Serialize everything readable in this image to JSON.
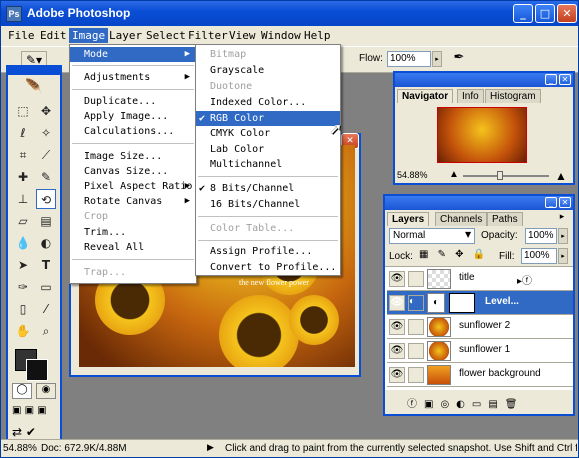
{
  "app": {
    "title": "Adobe Photoshop",
    "icon": "Ps"
  },
  "window_controls": {
    "minimize": "_",
    "maximize": "□",
    "close": "✕"
  },
  "menubar": [
    "File",
    "Edit",
    "Image",
    "Layer",
    "Select",
    "Filter",
    "View",
    "Window",
    "Help"
  ],
  "options_bar": {
    "flow_label": "Flow:",
    "flow_value": "100%"
  },
  "image_menu": {
    "items": [
      {
        "label": "Mode",
        "submenu": true,
        "enabled": true,
        "selected": true
      },
      {
        "label": "Adjustments",
        "submenu": true,
        "enabled": true
      },
      {
        "label": "Duplicate...",
        "enabled": true
      },
      {
        "label": "Apply Image...",
        "enabled": true
      },
      {
        "label": "Calculations...",
        "enabled": true
      },
      {
        "label": "Image Size...",
        "enabled": true
      },
      {
        "label": "Canvas Size...",
        "enabled": true
      },
      {
        "label": "Pixel Aspect Ratio",
        "submenu": true,
        "enabled": true
      },
      {
        "label": "Rotate Canvas",
        "submenu": true,
        "enabled": true
      },
      {
        "label": "Crop",
        "enabled": false
      },
      {
        "label": "Trim...",
        "enabled": true
      },
      {
        "label": "Reveal All",
        "enabled": true
      },
      {
        "label": "Trap...",
        "enabled": false
      }
    ]
  },
  "mode_submenu": {
    "items": [
      {
        "label": "Bitmap",
        "enabled": false
      },
      {
        "label": "Grayscale",
        "enabled": true
      },
      {
        "label": "Duotone",
        "enabled": false
      },
      {
        "label": "Indexed Color...",
        "enabled": true
      },
      {
        "label": "RGB Color",
        "enabled": true,
        "checked": true,
        "selected": true
      },
      {
        "label": "CMYK Color",
        "enabled": true
      },
      {
        "label": "Lab Color",
        "enabled": true
      },
      {
        "label": "Multichannel",
        "enabled": true
      },
      {
        "label": "8 Bits/Channel",
        "enabled": true,
        "checked": true
      },
      {
        "label": "16 Bits/Channel",
        "enabled": true
      },
      {
        "label": "Color Table...",
        "enabled": false
      },
      {
        "label": "Assign Profile...",
        "enabled": true
      },
      {
        "label": "Convert to Profile...",
        "enabled": true
      }
    ]
  },
  "document": {
    "overlay_text": "the new flower power"
  },
  "navigator_panel": {
    "tabs": [
      "Navigator",
      "Info",
      "Histogram"
    ],
    "zoom": "54.88%"
  },
  "layers_panel": {
    "tabs": [
      "Layers",
      "Channels",
      "Paths"
    ],
    "blend_mode": "Normal",
    "opacity_label": "Opacity:",
    "opacity_value": "100%",
    "lock_label": "Lock:",
    "fill_label": "Fill:",
    "fill_value": "100%",
    "layers": [
      {
        "name": "title",
        "selected": false
      },
      {
        "name": "Level...",
        "selected": true
      },
      {
        "name": "sunflower 2",
        "selected": false
      },
      {
        "name": "sunflower 1",
        "selected": false
      },
      {
        "name": "flower background",
        "selected": false
      }
    ]
  },
  "status": {
    "doc_info": "Doc: 672.9K/4.88M",
    "zoom": "54.88%",
    "hint": "Click and drag to paint from the currently selected snapshot.  Use Shift and Ctrl for addit"
  },
  "colors": {
    "title_blue": "#0a4ed6",
    "menu_highlight": "#316ac5",
    "chrome": "#ece9d8"
  }
}
